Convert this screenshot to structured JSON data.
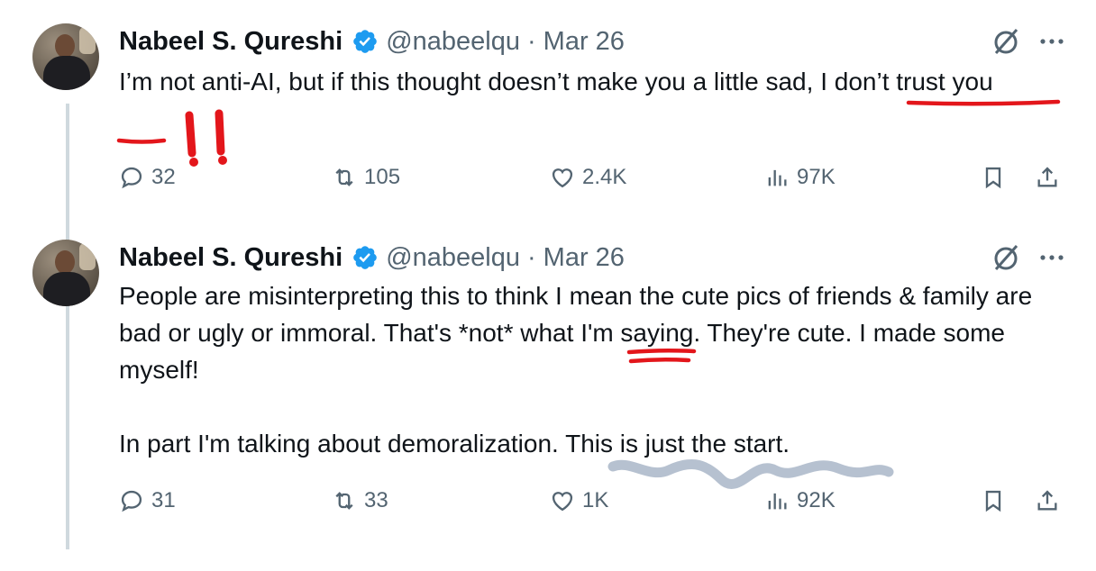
{
  "tweets": [
    {
      "author": "Nabeel S. Qureshi",
      "handle": "@nabeelqu",
      "date": "Mar 26",
      "text_before": "I’m not anti-AI, but if this thought doesn’t make you a little sad, ",
      "text_emph1": "I don’t trust",
      "text_emph2": "you",
      "replies": "32",
      "reposts": "105",
      "likes": "2.4K",
      "views": "97K"
    },
    {
      "author": "Nabeel S. Qureshi",
      "handle": "@nabeelqu",
      "date": "Mar 26",
      "text_a": "People are misinterpreting this to think I mean the cute pics of friends & family are bad or ugly or immoral. That's ",
      "text_not": "*not*",
      "text_b": " what I'm saying. They're cute. I made some myself!",
      "text_c": "In part I'm talking about demoralization. This is just the start.",
      "replies": "31",
      "reposts": "33",
      "likes": "1K",
      "views": "92K"
    }
  ],
  "icons": {
    "verified": "verified-badge-icon",
    "grok": "grok-icon",
    "more": "more-icon",
    "reply": "reply-icon",
    "repost": "repost-icon",
    "like": "like-icon",
    "views": "views-icon",
    "bookmark": "bookmark-icon",
    "share": "share-icon"
  },
  "colors": {
    "verified": "#1d9bf0",
    "secondary_text": "#536471",
    "annotation_red": "#e3161b",
    "annotation_scribble": "#a9b6c8"
  }
}
